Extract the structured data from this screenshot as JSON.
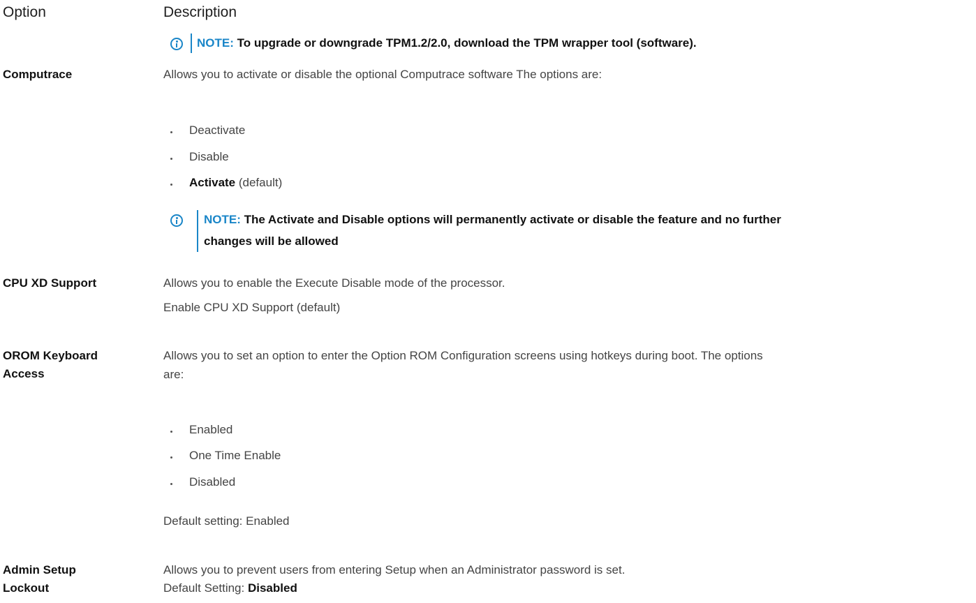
{
  "header": {
    "option_label": "Option",
    "description_label": "Description"
  },
  "tpm_note": {
    "label": "NOTE:",
    "text": " To upgrade or downgrade TPM1.2/2.0, download the TPM wrapper tool (software)."
  },
  "computrace": {
    "name": "Computrace",
    "description": "Allows you to activate or disable the optional Computrace software The options are:",
    "options": [
      "Deactivate",
      "Disable"
    ],
    "default_option": "Activate",
    "default_suffix": " (default)",
    "note_label": "NOTE:",
    "note_line1": " The Activate and Disable options will permanently activate or disable the feature and no further",
    "note_line2": "changes will be allowed"
  },
  "cpu_xd": {
    "name": "CPU XD Support",
    "description": "Allows you to enable the Execute Disable mode of the processor.",
    "default_text": "Enable CPU XD Support (default)"
  },
  "orom": {
    "name_line1": "OROM Keyboard",
    "name_line2": "Access",
    "description_line1": "Allows you to set an option to enter the Option ROM Configuration screens using hotkeys during boot. The options",
    "description_line2": "are:",
    "options": [
      "Enabled",
      "One Time Enable",
      "Disabled"
    ],
    "default_text": "Default setting: Enabled"
  },
  "admin_lockout": {
    "name_line1": "Admin Setup",
    "name_line2": "Lockout",
    "description": "Allows you to prevent users from entering Setup when an Administrator password is set.",
    "default_prefix": "Default Setting: ",
    "default_value": "Disabled"
  },
  "colors": {
    "note_accent": "#1a86c8",
    "body_text": "#444444",
    "bold_text": "#111111"
  }
}
